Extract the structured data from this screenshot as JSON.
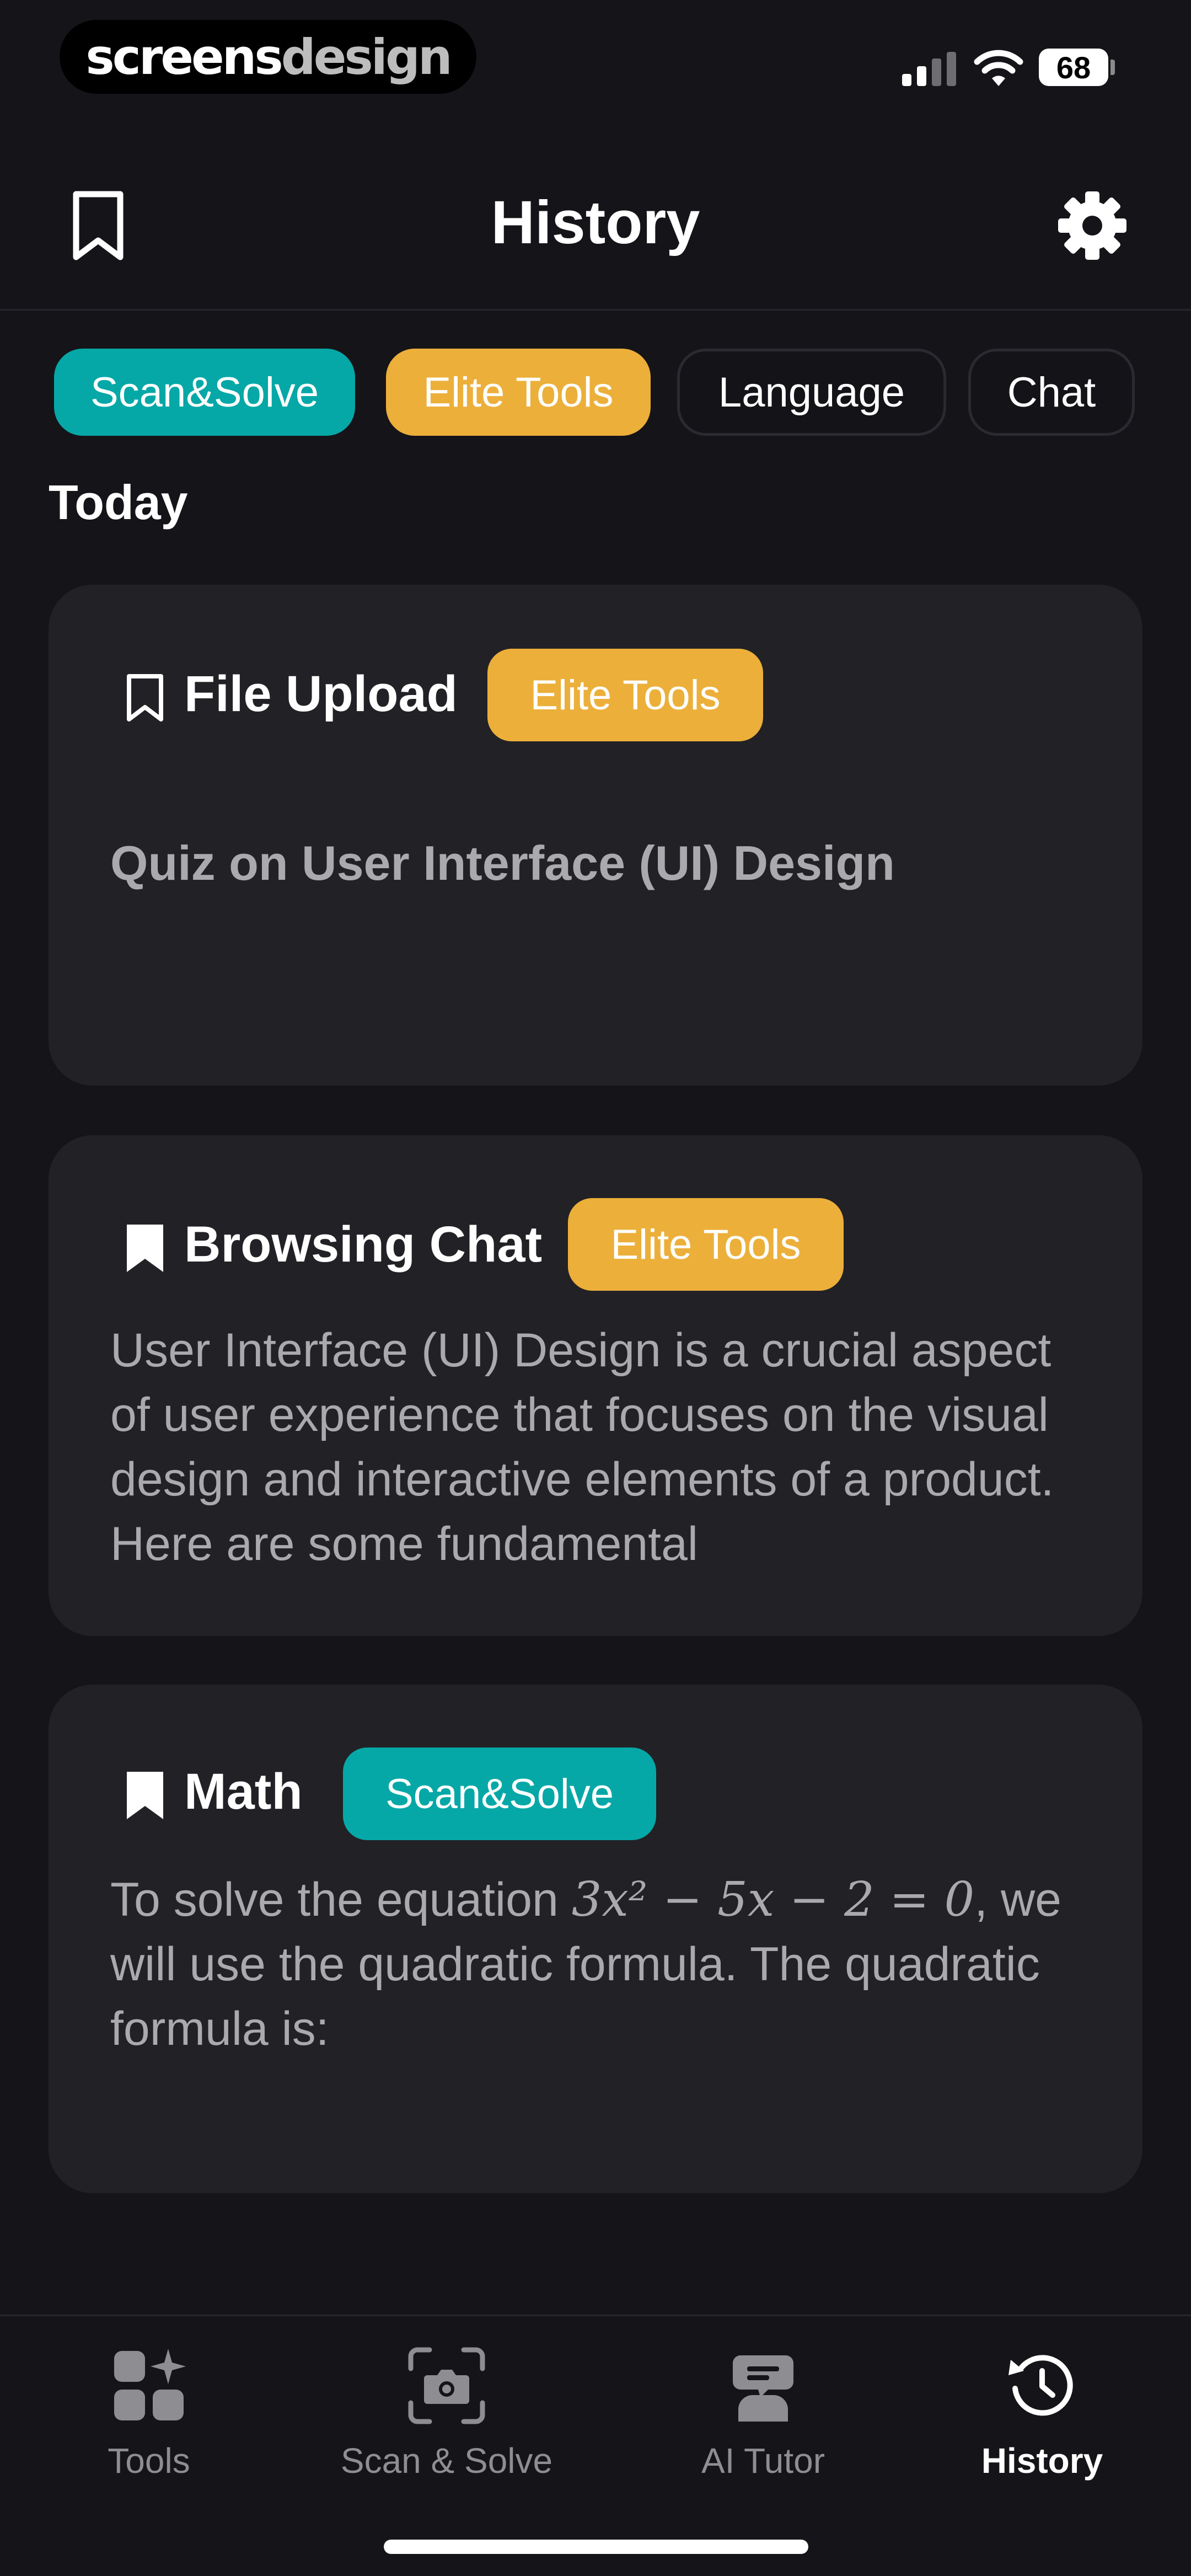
{
  "status_bar": {
    "brand_primary": "screens",
    "brand_secondary": "design",
    "battery": "68"
  },
  "header": {
    "title": "History",
    "bookmark_icon": "bookmark-icon",
    "settings_icon": "gear-icon"
  },
  "filters": [
    {
      "label": "Scan&Solve",
      "color": "#06a7a7"
    },
    {
      "label": "Elite Tools",
      "color": "#ecb03a"
    },
    {
      "label": "Language"
    },
    {
      "label": "Chat"
    }
  ],
  "section_title": "Today",
  "cards": [
    {
      "title": "File Upload",
      "badge": "Elite Tools",
      "badge_color": "#ecb03a",
      "bookmarked": false,
      "body": "Quiz on User Interface (UI) Design"
    },
    {
      "title": "Browsing Chat",
      "badge": "Elite Tools",
      "badge_color": "#ecb03a",
      "bookmarked": true,
      "body": "User Interface (UI) Design is a crucial aspect of user experience that focuses on the visual design and interactive elements of a product. Here are some fundamental"
    },
    {
      "title": "Math",
      "badge": "Scan&Solve",
      "badge_color": "#06a7a7",
      "bookmarked": true,
      "body_prefix": "To solve the equation ",
      "equation": "3x² − 5x − 2 = 0",
      "body_suffix": ", we will use the quadratic formula. The quadratic formula is:"
    }
  ],
  "bottom_nav": [
    {
      "label": "Tools",
      "icon": "tools-grid-icon"
    },
    {
      "label": "Scan & Solve",
      "icon": "camera-scan-icon"
    },
    {
      "label": "AI Tutor",
      "icon": "ai-tutor-icon"
    },
    {
      "label": "History",
      "icon": "history-clock-icon",
      "active": true
    }
  ]
}
